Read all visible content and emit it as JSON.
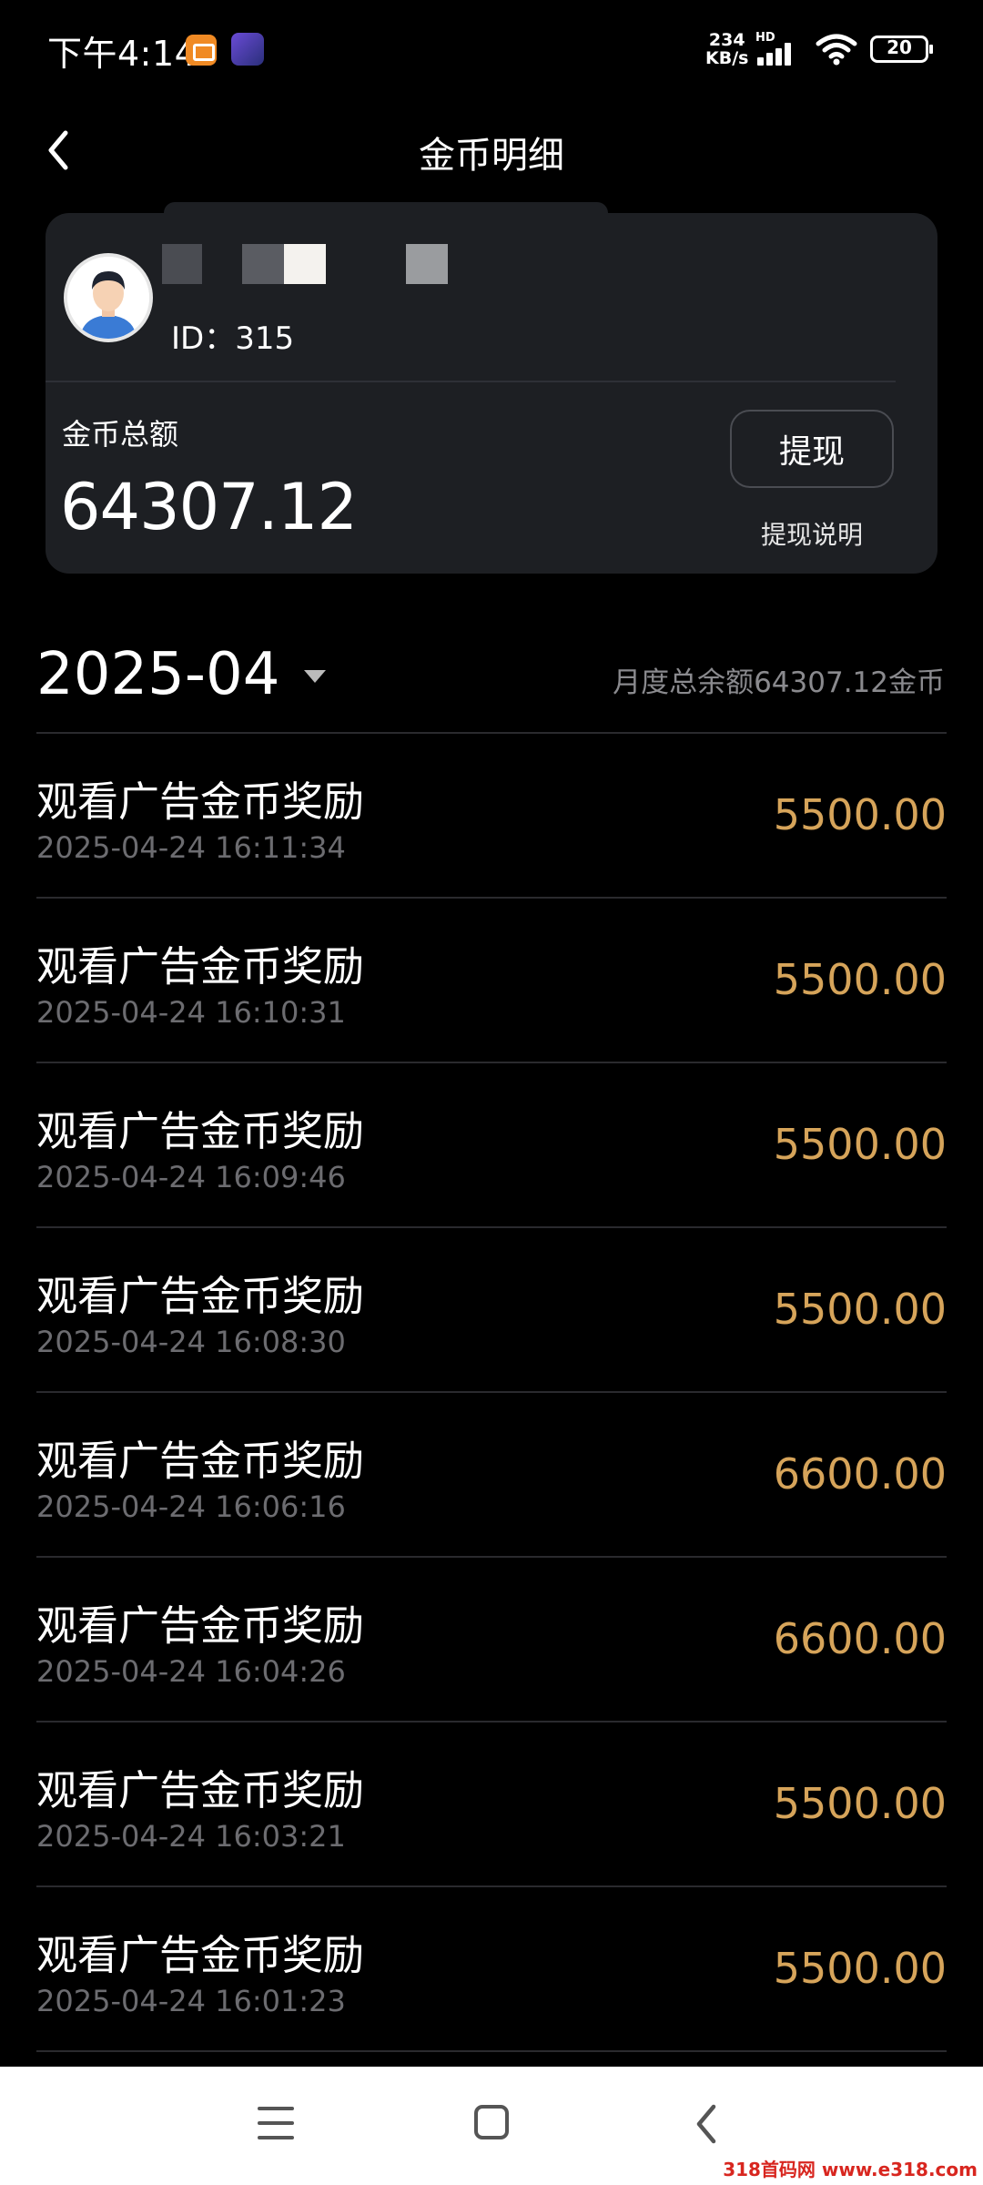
{
  "status_bar": {
    "time": "下午4:14",
    "net_speed_value": "234",
    "net_speed_unit": "KB/s",
    "hd_label": "HD",
    "battery": "20"
  },
  "nav": {
    "title": "金币明细"
  },
  "account": {
    "id_label": "ID：315",
    "total_label": "金币总额",
    "total_value": "64307.12",
    "withdraw_label": "提现",
    "withdraw_help_label": "提现说明"
  },
  "month_header": {
    "month": "2025-04",
    "summary": "月度总余额64307.12金币"
  },
  "transactions": [
    {
      "title": "观看广告金币奖励",
      "time": "2025-04-24 16:11:34",
      "amount": "5500.00"
    },
    {
      "title": "观看广告金币奖励",
      "time": "2025-04-24 16:10:31",
      "amount": "5500.00"
    },
    {
      "title": "观看广告金币奖励",
      "time": "2025-04-24 16:09:46",
      "amount": "5500.00"
    },
    {
      "title": "观看广告金币奖励",
      "time": "2025-04-24 16:08:30",
      "amount": "5500.00"
    },
    {
      "title": "观看广告金币奖励",
      "time": "2025-04-24 16:06:16",
      "amount": "6600.00"
    },
    {
      "title": "观看广告金币奖励",
      "time": "2025-04-24 16:04:26",
      "amount": "6600.00"
    },
    {
      "title": "观看广告金币奖励",
      "time": "2025-04-24 16:03:21",
      "amount": "5500.00"
    },
    {
      "title": "观看广告金币奖励",
      "time": "2025-04-24 16:01:23",
      "amount": "5500.00"
    }
  ],
  "watermark": "318首码网 www.e318.com",
  "colors": {
    "background": "#000000",
    "card": "#1d1f23",
    "amount": "#d6a45a",
    "secondary_text": "#6c6c70"
  }
}
